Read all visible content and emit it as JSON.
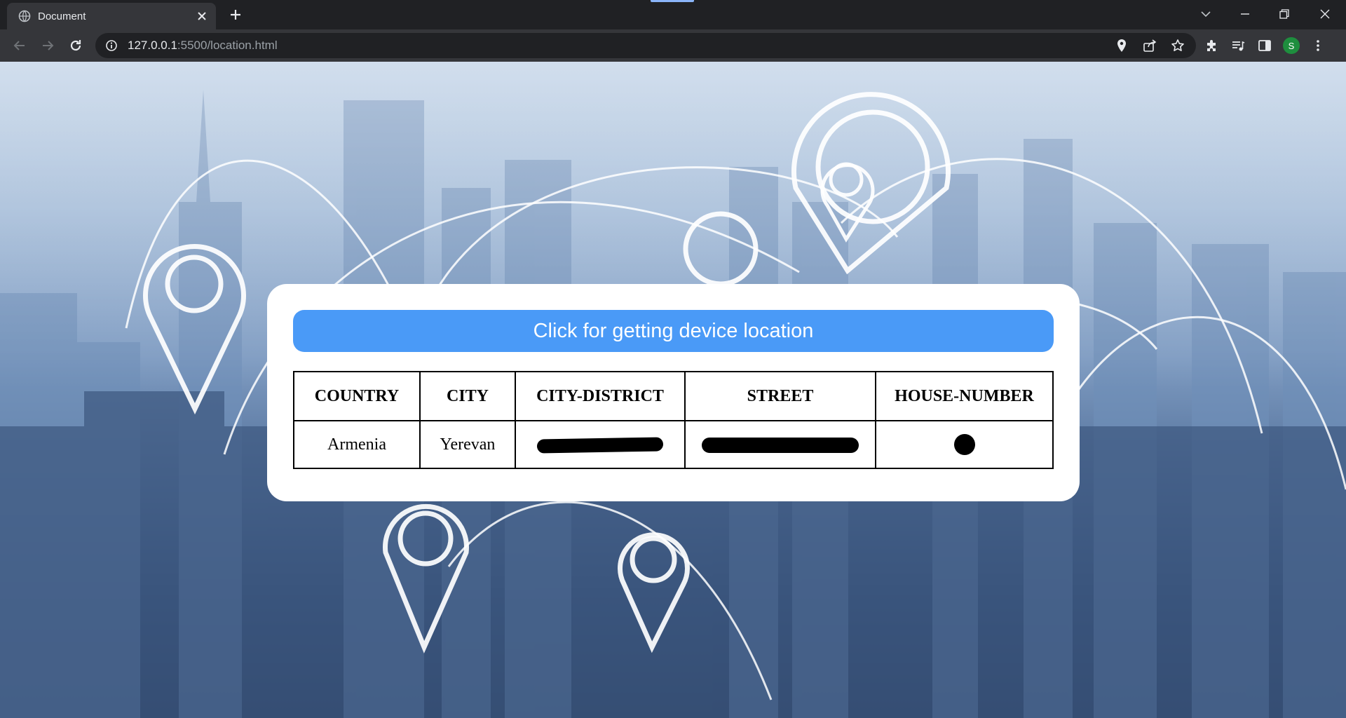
{
  "browser": {
    "tab_title": "Document",
    "url_host": "127.0.0.1",
    "url_path": ":5500/location.html",
    "avatar_letter": "S",
    "icons": {
      "favicon": "globe-icon",
      "tab_close": "close-icon",
      "new_tab": "plus-icon",
      "tab_search": "chevron-down-icon",
      "minimize": "minimize-icon",
      "restore": "restore-icon",
      "close_window": "close-icon",
      "back": "arrow-left-icon",
      "forward": "arrow-right-icon",
      "reload": "reload-icon",
      "site_info": "info-icon",
      "location": "location-pin-icon",
      "share": "share-icon",
      "bookmark": "star-icon",
      "extensions": "puzzle-icon",
      "media": "media-queue-icon",
      "side_panel": "side-panel-icon",
      "menu": "kebab-menu-icon"
    }
  },
  "page": {
    "button_label": "Click for getting device location",
    "table": {
      "headers": [
        "COUNTRY",
        "CITY",
        "CITY-DISTRICT",
        "STREET",
        "HOUSE-NUMBER"
      ],
      "row": [
        "Armenia",
        "Yerevan",
        "",
        "",
        ""
      ]
    },
    "colors": {
      "button": "#4a9af7",
      "card": "#ffffff",
      "redaction": "#000000"
    }
  }
}
